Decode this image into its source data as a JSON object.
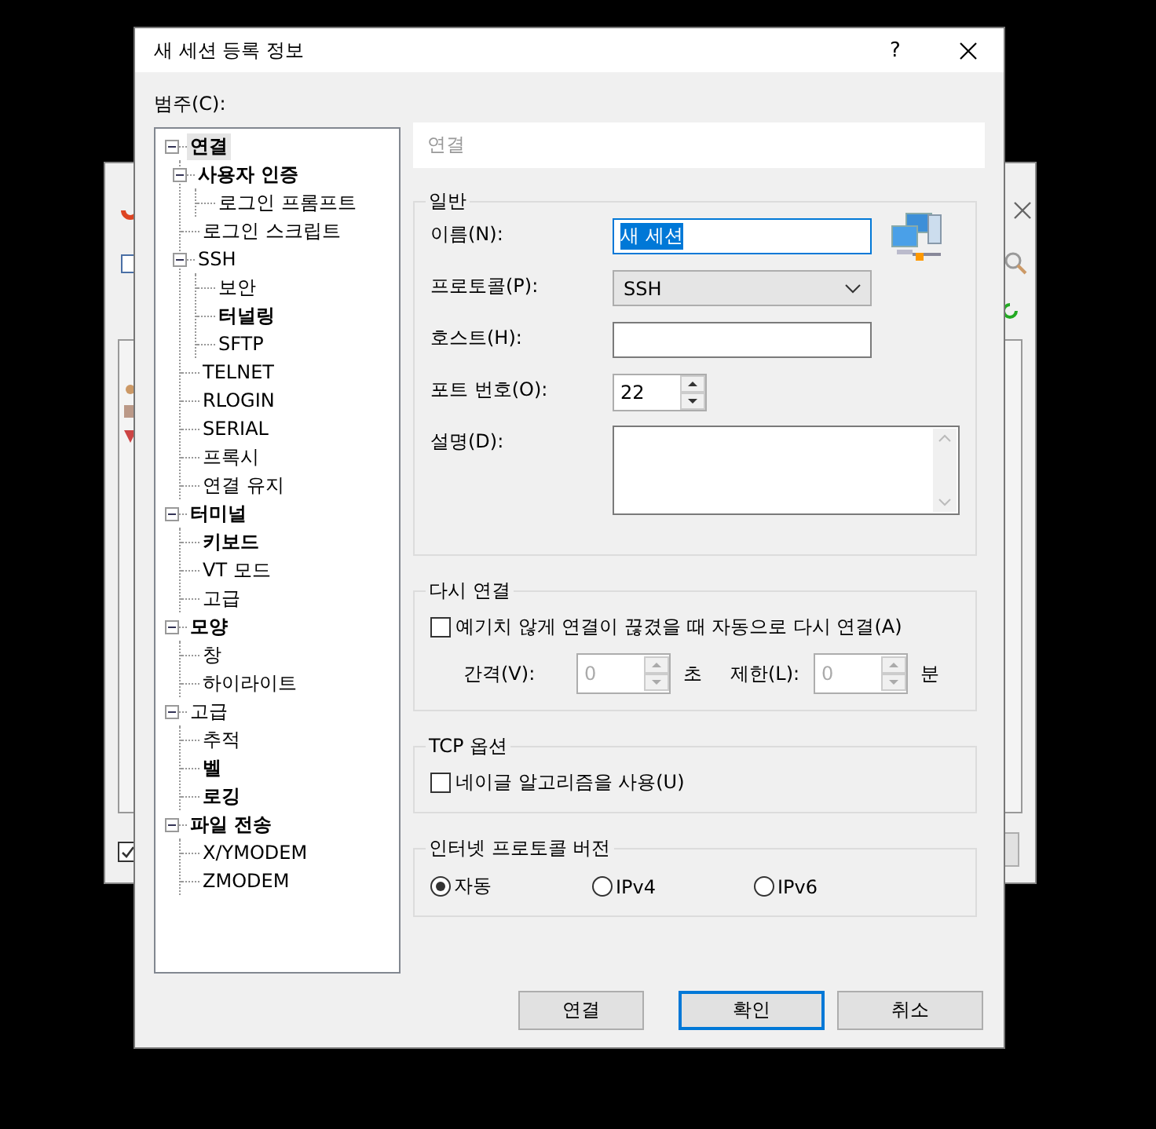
{
  "background_window": {
    "checkbox_checked": true
  },
  "window": {
    "title": "새 세션 등록 정보",
    "help_button": "?"
  },
  "category_label": "범주(C):",
  "tree": [
    {
      "label": "연결",
      "bold": true,
      "selected": true,
      "expanded": true,
      "children": [
        {
          "label": "사용자 인증",
          "bold": true,
          "selected": false,
          "expanded": true,
          "children": [
            {
              "label": "로그인 프롬프트",
              "bold": false,
              "selected": false
            }
          ]
        },
        {
          "label": "로그인 스크립트",
          "bold": false,
          "selected": false
        },
        {
          "label": "SSH",
          "bold": false,
          "selected": false,
          "expanded": true,
          "children": [
            {
              "label": "보안",
              "bold": false,
              "selected": false
            },
            {
              "label": "터널링",
              "bold": true,
              "selected": false
            },
            {
              "label": "SFTP",
              "bold": false,
              "selected": false
            }
          ]
        },
        {
          "label": "TELNET",
          "bold": false,
          "selected": false
        },
        {
          "label": "RLOGIN",
          "bold": false,
          "selected": false
        },
        {
          "label": "SERIAL",
          "bold": false,
          "selected": false
        },
        {
          "label": "프록시",
          "bold": false,
          "selected": false
        },
        {
          "label": "연결 유지",
          "bold": false,
          "selected": false
        }
      ]
    },
    {
      "label": "터미널",
      "bold": true,
      "selected": false,
      "expanded": true,
      "children": [
        {
          "label": "키보드",
          "bold": true,
          "selected": false
        },
        {
          "label": "VT 모드",
          "bold": false,
          "selected": false
        },
        {
          "label": "고급",
          "bold": false,
          "selected": false
        }
      ]
    },
    {
      "label": "모양",
      "bold": true,
      "selected": false,
      "expanded": true,
      "children": [
        {
          "label": "창",
          "bold": false,
          "selected": false
        },
        {
          "label": "하이라이트",
          "bold": false,
          "selected": false
        }
      ]
    },
    {
      "label": "고급",
      "bold": false,
      "selected": false,
      "expanded": true,
      "children": [
        {
          "label": "추적",
          "bold": false,
          "selected": false
        },
        {
          "label": "벨",
          "bold": true,
          "selected": false
        },
        {
          "label": "로깅",
          "bold": true,
          "selected": false
        }
      ]
    },
    {
      "label": "파일 전송",
      "bold": true,
      "selected": false,
      "expanded": true,
      "children": [
        {
          "label": "X/YMODEM",
          "bold": false,
          "selected": false
        },
        {
          "label": "ZMODEM",
          "bold": false,
          "selected": false
        }
      ]
    }
  ],
  "panel_title": "연결",
  "general": {
    "title": "일반",
    "fields": [
      {
        "kind": "text",
        "label": "이름(N):",
        "value": "새 세션",
        "text_selected": true
      },
      {
        "kind": "dropdown",
        "label": "프로토콜(P):",
        "value": "SSH"
      },
      {
        "kind": "text",
        "label": "호스트(H):"
      },
      {
        "kind": "spin",
        "label": "포트 번호(O):",
        "value": "22"
      },
      {
        "kind": "textarea",
        "label": "설명(D):"
      }
    ]
  },
  "reconnect": {
    "title": "다시 연결",
    "checkbox": {
      "label": "예기치 않게 연결이 끊겼을 때 자동으로 다시 연결(A)",
      "checked": false
    },
    "interval": {
      "label": "간격(V):",
      "value": "0",
      "unit": "초",
      "disabled": true
    },
    "limit": {
      "label": "제한(L):",
      "value": "0",
      "unit": "분",
      "disabled": true
    }
  },
  "tcp_options": {
    "title": "TCP 옵션",
    "checkbox": {
      "label": "네이글 알고리즘을 사용(U)",
      "checked": false
    }
  },
  "ip_version": {
    "title": "인터넷 프로토콜 버전",
    "options": [
      {
        "label": "자동",
        "selected": true
      },
      {
        "label": "IPv4",
        "selected": false
      },
      {
        "label": "IPv6",
        "selected": false
      }
    ]
  },
  "buttons": [
    {
      "label": "연결",
      "default": false
    },
    {
      "label": "확인",
      "default": true
    },
    {
      "label": "취소",
      "default": false
    }
  ]
}
